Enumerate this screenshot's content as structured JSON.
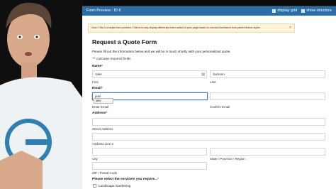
{
  "window": {
    "title": "Form Preview : ID 6",
    "options": [
      {
        "label": "display grid",
        "checked": true
      },
      {
        "label": "show structure",
        "checked": true
      }
    ]
  },
  "notice": {
    "text": "Note: This is a simple form preview. This form may display differently when added to your page based on normal inheritance from parent theme styles.",
    "close": "×"
  },
  "form": {
    "title": "Request a Quote Form",
    "description": "Please fill out the information below and we will be in touch shortly with your personalized quote.",
    "required_note": "\"*\" indicates required fields",
    "required_mark": "*",
    "name": {
      "label": "Name",
      "first_value": "Jake",
      "last_value": "Jackson",
      "first_label": "First",
      "last_label": "Last"
    },
    "email": {
      "label": "Email",
      "value": "jake",
      "enter_label": "Enter Email",
      "confirm_label": "Confirm Email",
      "autocomplete": "jake"
    },
    "address": {
      "label": "Address",
      "street_label": "Street Address",
      "line2_label": "Address Line 2",
      "city_label": "City",
      "state_label": "State / Province / Region",
      "zip_label": "ZIP / Postal Code"
    },
    "services": {
      "label": "Please select the service/s you require...",
      "options": [
        "Landscape Gardening"
      ]
    }
  },
  "colors": {
    "titlebar": "#2a6ea5",
    "notice_bg": "#fdf3d7",
    "required": "#c02b2b",
    "focus": "#4a7fb5"
  }
}
